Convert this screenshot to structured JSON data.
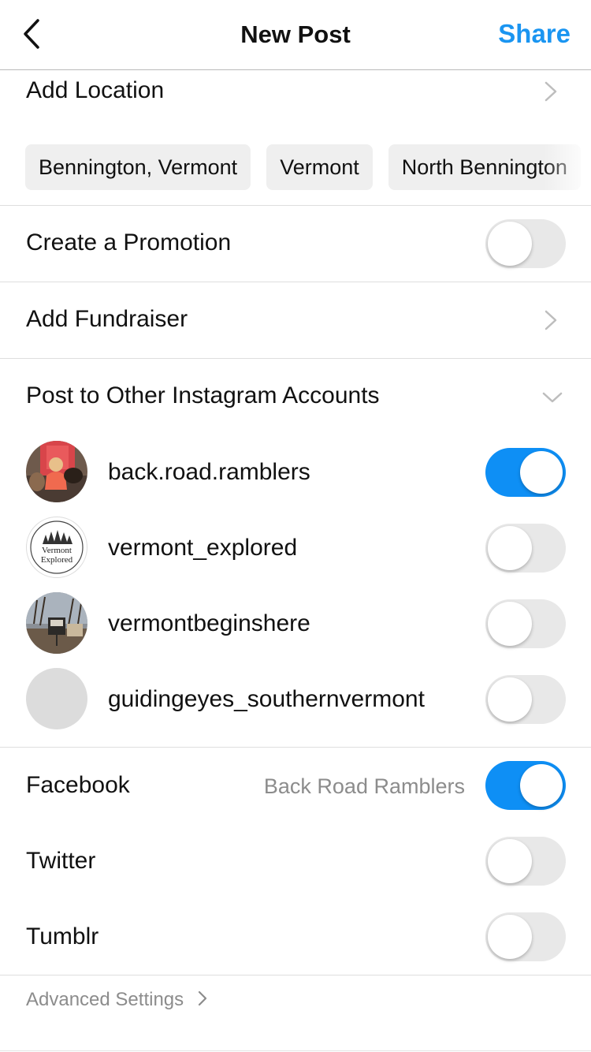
{
  "header": {
    "title": "New Post",
    "share_label": "Share"
  },
  "location": {
    "label": "Add Location",
    "suggestions": [
      "Bennington, Vermont",
      "Vermont",
      "North Bennington"
    ]
  },
  "promotion": {
    "label": "Create a Promotion",
    "enabled": false
  },
  "fundraiser": {
    "label": "Add Fundraiser"
  },
  "other_accounts": {
    "label": "Post to Other Instagram Accounts",
    "accounts": [
      {
        "username": "back.road.ramblers",
        "enabled": true
      },
      {
        "username": "vermont_explored",
        "enabled": false,
        "avatar_text_1": "Vermont",
        "avatar_text_2": "Explored"
      },
      {
        "username": "vermontbeginshere",
        "enabled": false
      },
      {
        "username": "guidingeyes_southernvermont",
        "enabled": false
      }
    ]
  },
  "sharing": {
    "facebook": {
      "label": "Facebook",
      "account": "Back Road Ramblers",
      "enabled": true
    },
    "twitter": {
      "label": "Twitter",
      "enabled": false
    },
    "tumblr": {
      "label": "Tumblr",
      "enabled": false
    }
  },
  "advanced": {
    "label": "Advanced Settings"
  },
  "colors": {
    "accent": "#1a95f1",
    "toggle_on": "#0e8ff5",
    "toggle_off": "#e8e8e8",
    "muted_text": "#8c8c8c"
  },
  "icons": [
    "back-chevron-icon",
    "chevron-right-icon",
    "chevron-down-icon"
  ]
}
